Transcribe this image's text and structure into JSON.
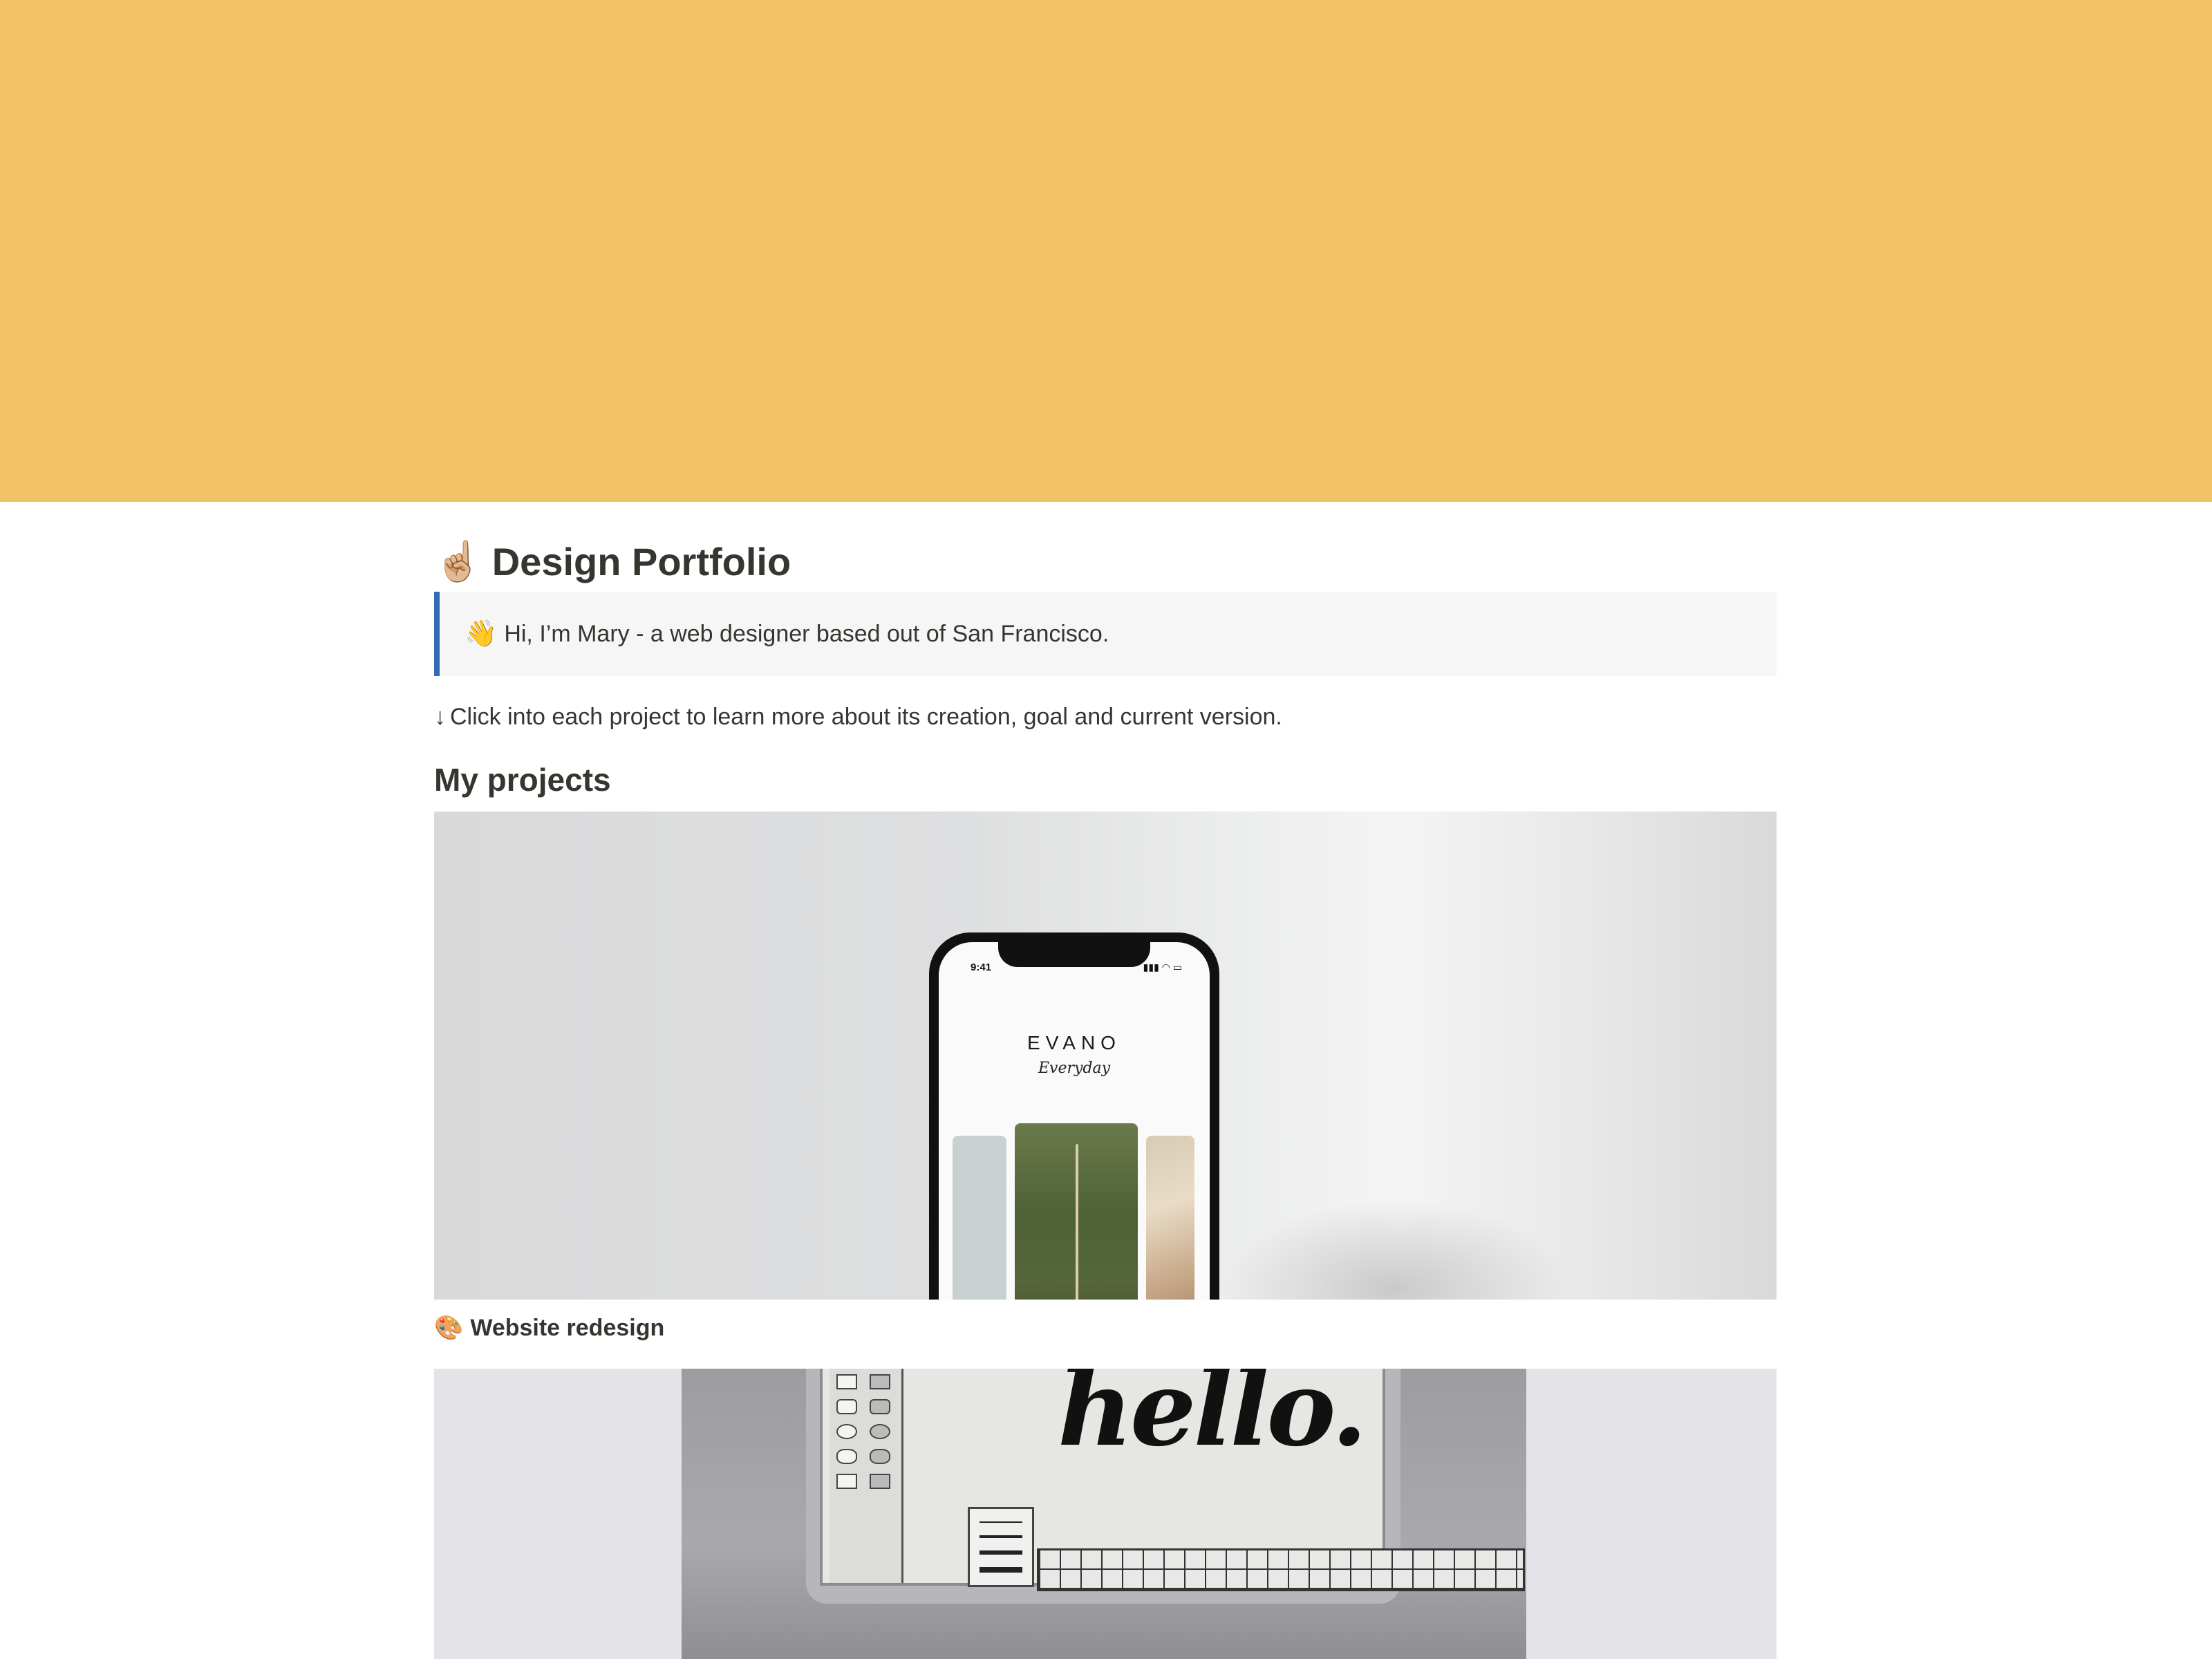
{
  "page": {
    "title_emoji": "☝🏼",
    "title": "Design Portfolio",
    "cover_color": "#f1c266"
  },
  "callout": {
    "emoji": "👋",
    "text": "Hi, I’m Mary - a web designer based out of San Francisco.",
    "accent_color": "#2f6db0"
  },
  "hint": {
    "arrow": "↓",
    "text": "Click into each project to learn more about its creation, goal and current version."
  },
  "section": {
    "heading": "My projects"
  },
  "projects": [
    {
      "emoji": "🎨",
      "title": "Website redesign",
      "cover": {
        "phone_time": "9:41",
        "phone_status": "▮▮▮ ◠ ▭",
        "brand": "EVANO",
        "brand_sub": "Everyday"
      }
    },
    {
      "cover": {
        "screen_text": "hello."
      }
    }
  ]
}
